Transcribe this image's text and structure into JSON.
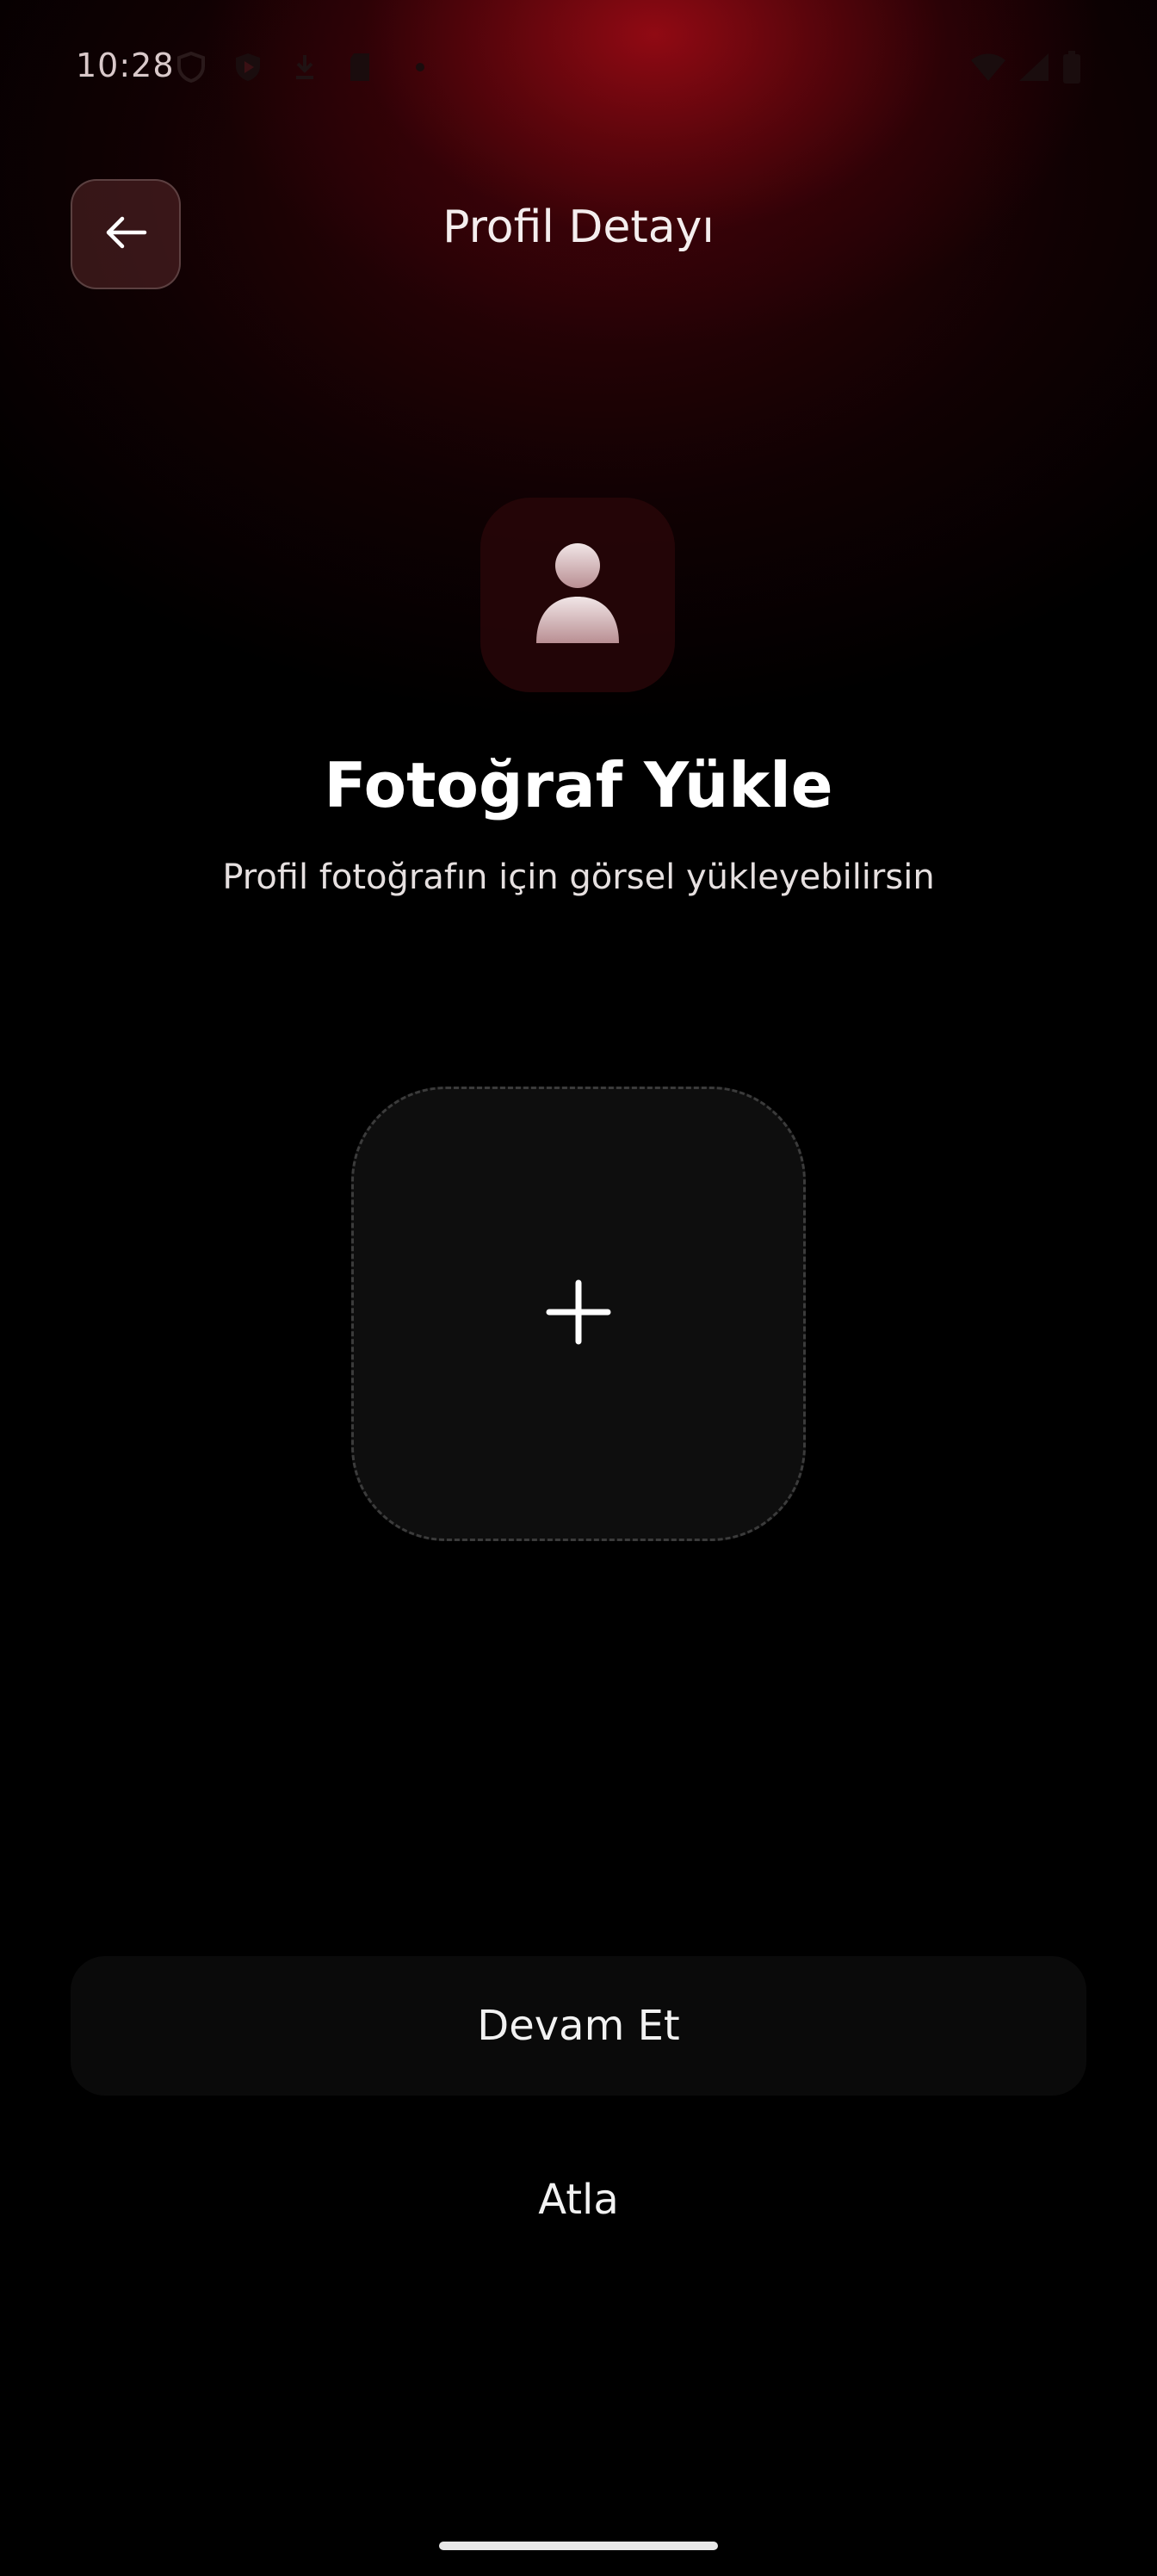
{
  "status_bar": {
    "time": "10:28",
    "icons": [
      "shield-icon",
      "play-protect-icon",
      "download-icon",
      "sd-card-icon",
      "dot-icon",
      "wifi-icon",
      "signal-icon",
      "battery-icon"
    ]
  },
  "header": {
    "title": "Profil Detayı",
    "back_icon": "arrow-left-icon"
  },
  "avatar": {
    "icon": "user-icon"
  },
  "upload": {
    "title": "Fotoğraf Yükle",
    "subtitle": "Profil fotoğrafın için görsel yükleyebilirsin",
    "add_icon": "plus-icon"
  },
  "actions": {
    "continue_label": "Devam Et",
    "skip_label": "Atla"
  },
  "colors": {
    "accent": "#8b0a12",
    "background": "#000000"
  }
}
